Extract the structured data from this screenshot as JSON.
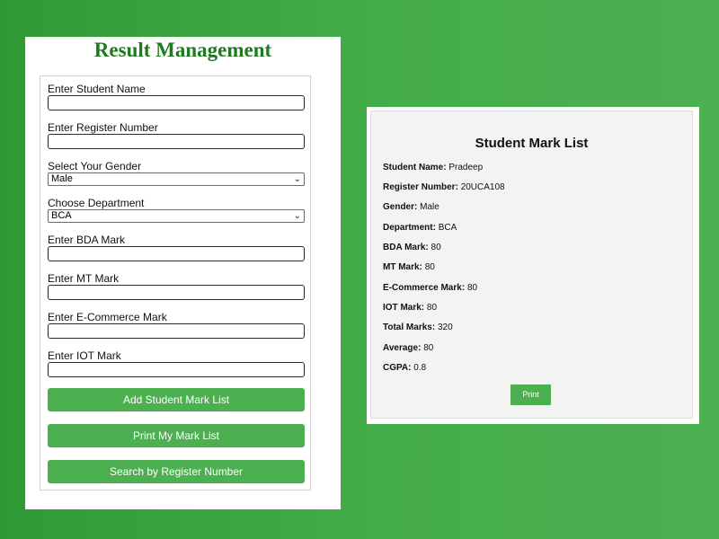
{
  "form": {
    "title": "Result Management",
    "student_name_label": "Enter Student Name",
    "register_number_label": "Enter Register Number",
    "gender_label": "Select Your Gender",
    "gender_value": "Male",
    "department_label": "Choose Department",
    "department_value": "BCA",
    "bda_label": "Enter BDA Mark",
    "mt_label": "Enter MT Mark",
    "ecommerce_label": "Enter E-Commerce Mark",
    "iot_label": "Enter IOT Mark",
    "add_button": "Add Student Mark List",
    "print_my_button": "Print My Mark List",
    "search_button": "Search by Register Number"
  },
  "marklist": {
    "title": "Student Mark List",
    "rows": [
      {
        "key": "Student Name:",
        "value": "Pradeep"
      },
      {
        "key": "Register Number:",
        "value": "20UCA108"
      },
      {
        "key": "Gender:",
        "value": "Male"
      },
      {
        "key": "Department:",
        "value": "BCA"
      },
      {
        "key": "BDA Mark:",
        "value": "80"
      },
      {
        "key": "MT Mark:",
        "value": "80"
      },
      {
        "key": "E-Commerce Mark:",
        "value": "80"
      },
      {
        "key": "IOT Mark:",
        "value": "80"
      },
      {
        "key": "Total Marks:",
        "value": "320"
      },
      {
        "key": "Average:",
        "value": "80"
      },
      {
        "key": "CGPA:",
        "value": "0.8"
      }
    ],
    "print_button": "Print"
  },
  "icons": {
    "select_chevron": "chevron-down-icon"
  },
  "colors": {
    "accent": "#4caf50",
    "title_green": "#1e7a1e"
  }
}
